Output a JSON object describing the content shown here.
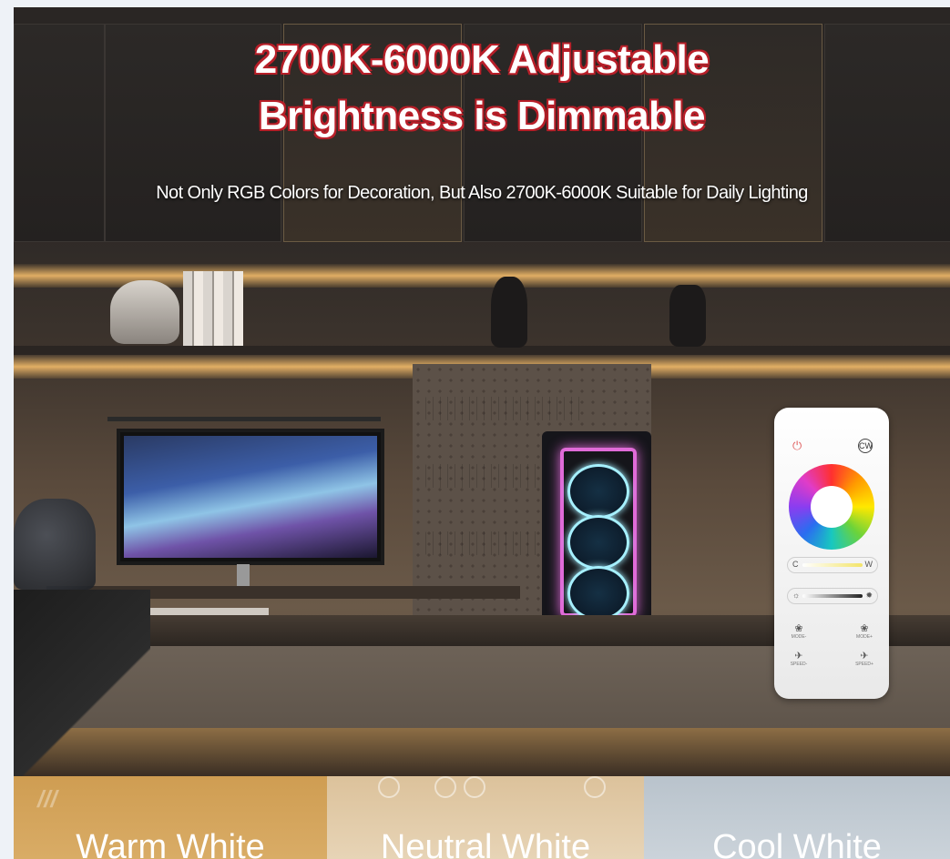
{
  "headline": {
    "line1": "2700K-6000K Adjustable",
    "line2": "Brightness is Dimmable"
  },
  "subheadline": "Not Only RGB Colors for Decoration, But Also 2700K-6000K Suitable for Daily Lighting",
  "remote": {
    "power_icon": "power-icon",
    "cw_label": "CW",
    "slider_cw": {
      "left": "C",
      "right": "W"
    },
    "slider_brightness": {
      "left": "☼",
      "right": "✹"
    },
    "mode_minus": "MODE-",
    "mode_plus": "MODE+",
    "speed_minus": "SPEED-",
    "speed_plus": "SPEED+"
  },
  "color_temps": [
    {
      "label": "Warm White",
      "color": "#d4a35c"
    },
    {
      "label": "Neutral White",
      "color": "#e2cba8"
    },
    {
      "label": "Cool White",
      "color": "#c2cbd3"
    }
  ],
  "colors": {
    "headline_outline": "#b8202a",
    "led_glow": "#ffc46e",
    "pc_accent": "#e06bd8"
  }
}
